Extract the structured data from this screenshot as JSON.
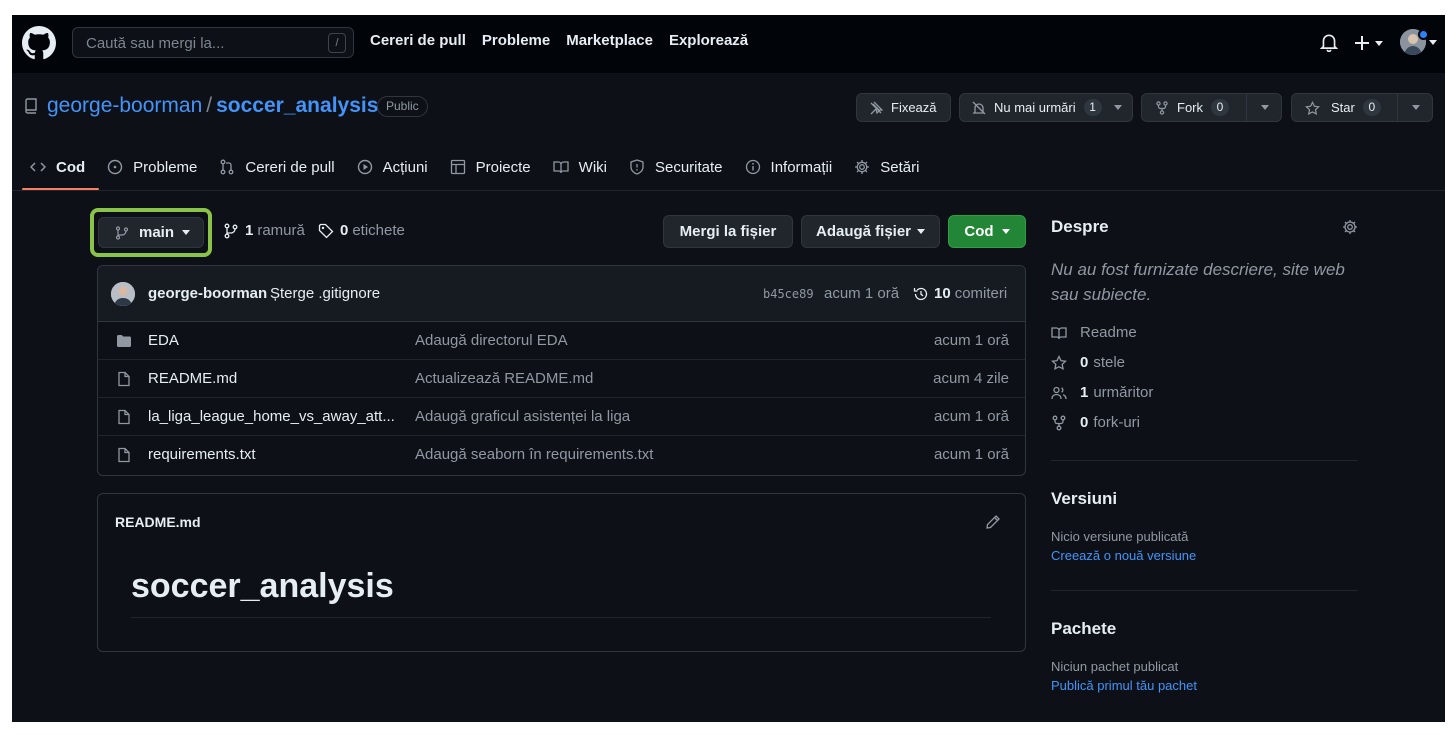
{
  "header": {
    "search_placeholder": "Caută sau mergi la...",
    "search_shortcut": "/",
    "nav": [
      "Cereri de pull",
      "Probleme",
      "Marketplace",
      "Explorează"
    ]
  },
  "repo": {
    "owner": "george-boorman",
    "separator": "/",
    "name": "soccer_analysis",
    "visibility": "Public",
    "actions": {
      "pin": "Fixează",
      "watch": "Nu mai urmări",
      "watch_count": "1",
      "fork": "Fork",
      "fork_count": "0",
      "star": "Star",
      "star_count": "0"
    }
  },
  "tabs": [
    {
      "label": "Cod",
      "icon": "code-icon",
      "active": true
    },
    {
      "label": "Probleme",
      "icon": "issue-icon"
    },
    {
      "label": "Cereri de pull",
      "icon": "pull-request-icon"
    },
    {
      "label": "Acțiuni",
      "icon": "play-icon"
    },
    {
      "label": "Proiecte",
      "icon": "table-icon"
    },
    {
      "label": "Wiki",
      "icon": "book-icon"
    },
    {
      "label": "Securitate",
      "icon": "shield-icon"
    },
    {
      "label": "Informații",
      "icon": "info-icon"
    },
    {
      "label": "Setări",
      "icon": "gear-icon"
    }
  ],
  "branch": {
    "current": "main",
    "branches_count": "1",
    "branches_label": "ramură",
    "tags_count": "0",
    "tags_label": "etichete",
    "goto_file": "Mergi la fișier",
    "add_file": "Adaugă fișier",
    "code": "Cod"
  },
  "commit": {
    "author": "george-boorman",
    "message": "Șterge .gitignore",
    "sha": "b45ce89",
    "time": "acum 1 oră",
    "count": "10",
    "count_label": "comiteri"
  },
  "files": [
    {
      "type": "folder",
      "name": "EDA",
      "message": "Adaugă directorul EDA",
      "time": "acum 1 oră"
    },
    {
      "type": "file",
      "name": "README.md",
      "message": "Actualizează README.md",
      "time": "acum 4 zile"
    },
    {
      "type": "file",
      "name": "la_liga_league_home_vs_away_att...",
      "message": "Adaugă graficul asistenței la liga",
      "time": "acum 1 oră"
    },
    {
      "type": "file",
      "name": "requirements.txt",
      "message": "Adaugă seaborn în requirements.txt",
      "time": "acum 1 oră"
    }
  ],
  "readme": {
    "filename": "README.md",
    "heading": "soccer_analysis"
  },
  "sidebar": {
    "about_title": "Despre",
    "description": "Nu au fost furnizate descriere, site web sau subiecte.",
    "readme": "Readme",
    "stars_count": "0",
    "stars_label": "stele",
    "watchers_count": "1",
    "watchers_label": "urmăritor",
    "forks_count": "0",
    "forks_label": "fork-uri",
    "releases_title": "Versiuni",
    "releases_none": "Nicio versiune publicată",
    "releases_link": "Creează o nouă versiune",
    "packages_title": "Pachete",
    "packages_none": "Niciun pachet publicat",
    "packages_link": "Publică primul tău pachet"
  },
  "colors": {
    "background": "#0d1117",
    "header": "#010409",
    "link": "#4493f8",
    "accent_tab": "#f78166",
    "code_button": "#238636",
    "branch_highlight": "#8bc34a"
  }
}
